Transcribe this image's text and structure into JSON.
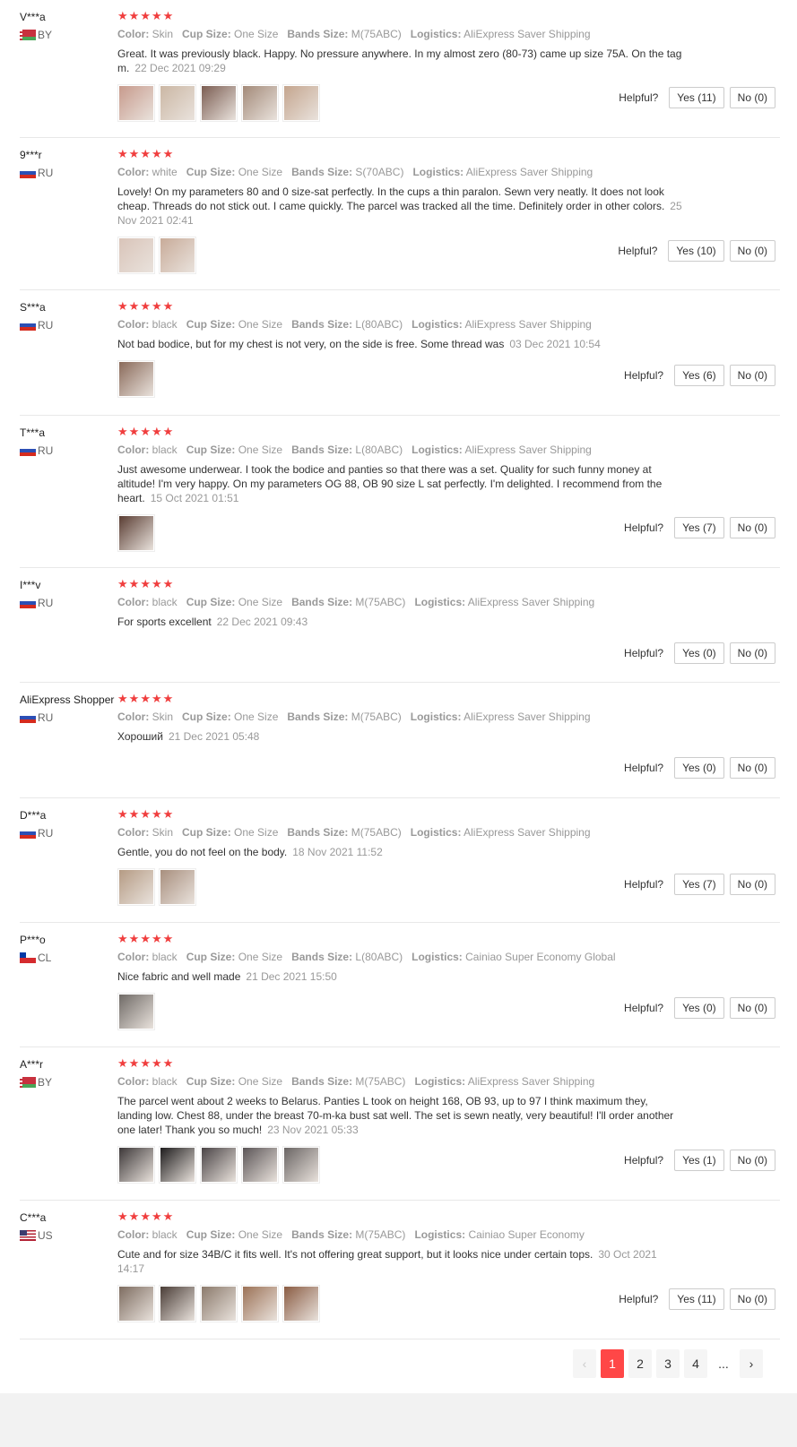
{
  "labels": {
    "color": "Color:",
    "cup_size": "Cup Size:",
    "bands_size": "Bands Size:",
    "logistics": "Logistics:",
    "helpful": "Helpful?"
  },
  "colors": {
    "star": "#f03e3e",
    "active_page": "#ff4747"
  },
  "reviews": [
    {
      "user": "V***a",
      "country": "BY",
      "flag": "by",
      "stars": 5,
      "color": "Skin",
      "cup_size": "One Size",
      "bands_size": "M(75ABC)",
      "logistics": "AliExpress Saver Shipping",
      "text": "Great. It was previously black. Happy. No pressure anywhere. In my almost zero (80-73) came up size 75A. On the tag m.",
      "date": "22 Dec 2021 09:29",
      "photos": [
        "#c79a8c",
        "#cbb7a4",
        "#7b5d52",
        "#a38a79",
        "#c4a58e"
      ],
      "yes": "Yes (11)",
      "no": "No (0)"
    },
    {
      "user": "9***r",
      "country": "RU",
      "flag": "ru",
      "stars": 5,
      "color": "white",
      "cup_size": "One Size",
      "bands_size": "S(70ABC)",
      "logistics": "AliExpress Saver Shipping",
      "text": "Lovely! On my parameters 80 and 0 size-sat perfectly. In the cups a thin paralon. Sewn very neatly. It does not look cheap. Threads do not stick out. I came quickly. The parcel was tracked all the time. Definitely order in other colors.",
      "date": "25 Nov 2021 02:41",
      "photos": [
        "#d9c4b9",
        "#c8ab99"
      ],
      "yes": "Yes (10)",
      "no": "No (0)"
    },
    {
      "user": "S***a",
      "country": "RU",
      "flag": "ru",
      "stars": 5,
      "color": "black",
      "cup_size": "One Size",
      "bands_size": "L(80ABC)",
      "logistics": "AliExpress Saver Shipping",
      "text": "Not bad bodice, but for my chest is not very, on the side is free. Some thread was",
      "date": "03 Dec 2021 10:54",
      "photos": [
        "#8a6a5a"
      ],
      "yes": "Yes (6)",
      "no": "No (0)"
    },
    {
      "user": "T***a",
      "country": "RU",
      "flag": "ru",
      "stars": 5,
      "color": "black",
      "cup_size": "One Size",
      "bands_size": "L(80ABC)",
      "logistics": "AliExpress Saver Shipping",
      "text": "Just awesome underwear. I took the bodice and panties so that there was a set. Quality for such funny money at altitude! I'm very happy. On my parameters OG 88, OB 90 size L sat perfectly. I'm delighted. I recommend from the heart.",
      "date": "15 Oct 2021 01:51",
      "photos": [
        "#5a3d33"
      ],
      "yes": "Yes (7)",
      "no": "No (0)"
    },
    {
      "user": "I***v",
      "country": "RU",
      "flag": "ru",
      "stars": 5,
      "color": "black",
      "cup_size": "One Size",
      "bands_size": "M(75ABC)",
      "logistics": "AliExpress Saver Shipping",
      "text": "For sports excellent",
      "date": "22 Dec 2021 09:43",
      "photos": [],
      "yes": "Yes (0)",
      "no": "No (0)"
    },
    {
      "user": "AliExpress Shopper",
      "country": "RU",
      "flag": "ru",
      "stars": 5,
      "color": "Skin",
      "cup_size": "One Size",
      "bands_size": "M(75ABC)",
      "logistics": "AliExpress Saver Shipping",
      "text": "Хороший",
      "date": "21 Dec 2021 05:48",
      "photos": [],
      "yes": "Yes (0)",
      "no": "No (0)"
    },
    {
      "user": "D***a",
      "country": "RU",
      "flag": "ru",
      "stars": 5,
      "color": "Skin",
      "cup_size": "One Size",
      "bands_size": "M(75ABC)",
      "logistics": "AliExpress Saver Shipping",
      "text": "Gentle, you do not feel on the body.",
      "date": "18 Nov 2021 11:52",
      "photos": [
        "#b59b84",
        "#a88f7e"
      ],
      "yes": "Yes (7)",
      "no": "No (0)"
    },
    {
      "user": "P***o",
      "country": "CL",
      "flag": "cl",
      "stars": 5,
      "color": "black",
      "cup_size": "One Size",
      "bands_size": "L(80ABC)",
      "logistics": "Cainiao Super Economy Global",
      "text": "Nice fabric and well made",
      "date": "21 Dec 2021 15:50",
      "photos": [
        "#6f6a66"
      ],
      "yes": "Yes (0)",
      "no": "No (0)"
    },
    {
      "user": "A***r",
      "country": "BY",
      "flag": "by",
      "stars": 5,
      "color": "black",
      "cup_size": "One Size",
      "bands_size": "M(75ABC)",
      "logistics": "AliExpress Saver Shipping",
      "text": "The parcel went about 2 weeks to Belarus. Panties L took on height 168, OB 93, up to 97 I think maximum they, landing low. Chest 88, under the breast 70-m-ka bust sat well. The set is sewn neatly, very beautiful! I'll order another one later! Thank you so much!",
      "date": "23 Nov 2021 05:33",
      "photos": [
        "#3d3839",
        "#1e1c1d",
        "#4a4446",
        "#5b5557",
        "#6a6564"
      ],
      "yes": "Yes (1)",
      "no": "No (0)"
    },
    {
      "user": "C***a",
      "country": "US",
      "flag": "us",
      "stars": 5,
      "color": "black",
      "cup_size": "One Size",
      "bands_size": "M(75ABC)",
      "logistics": "Cainiao Super Economy",
      "text": "Cute and for size 34B/C it fits well. It's not offering great support, but it looks nice under certain tops.",
      "date": "30 Oct 2021 14:17",
      "photos": [
        "#7e6d61",
        "#4a3d37",
        "#8b7a6c",
        "#9c7257",
        "#8a5c43"
      ],
      "yes": "Yes (11)",
      "no": "No (0)"
    }
  ],
  "pagination": {
    "prev": "‹",
    "pages": [
      "1",
      "2",
      "3",
      "4"
    ],
    "active": "1",
    "ellipsis": "...",
    "next": "›"
  }
}
